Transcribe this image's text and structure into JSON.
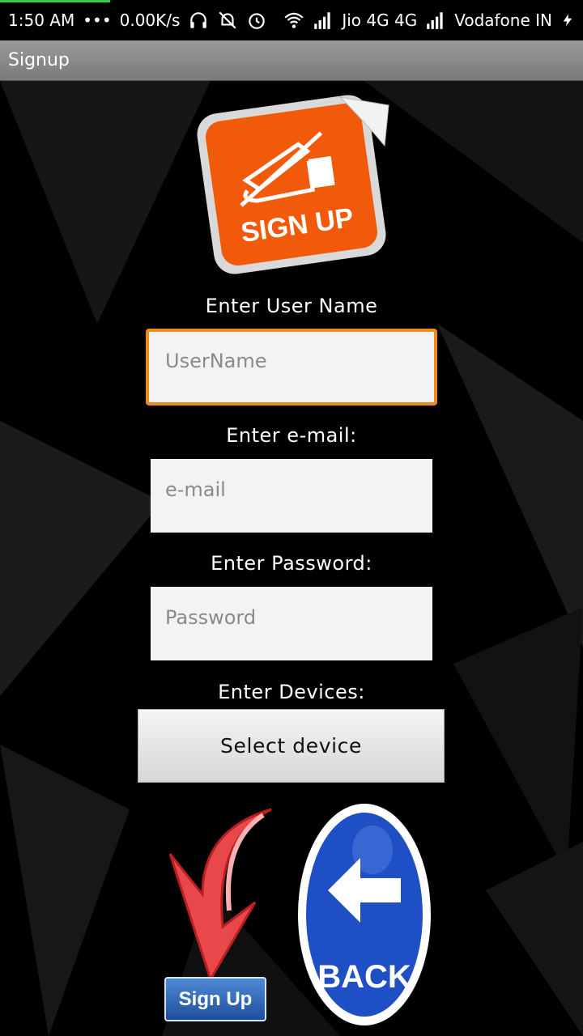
{
  "status_bar": {
    "time": "1:50 AM",
    "dots": "•••",
    "speed": "0.00K/s",
    "carrier1": "Jio 4G 4G",
    "carrier2": "Vodafone IN",
    "icons": [
      "headphones-icon",
      "bell-off-icon",
      "alarm-icon",
      "wifi-icon",
      "signal-icon",
      "signal-icon",
      "bolt-icon"
    ]
  },
  "action_bar": {
    "title": "Signup"
  },
  "logo": {
    "text": "SIGN UP"
  },
  "form": {
    "username_label": "Enter User Name",
    "username_placeholder": "UserName",
    "email_label": "Enter e-mail:",
    "email_placeholder": "e-mail",
    "password_label": "Enter Password:",
    "password_placeholder": "Password",
    "devices_label": "Enter Devices:",
    "select_device": "Select device"
  },
  "buttons": {
    "signup": "Sign Up",
    "back": "BACK"
  },
  "colors": {
    "accent_orange": "#f08a1c",
    "logo_orange": "#f05a0a",
    "back_blue": "#1f4fc4",
    "arrow_red": "#e8484a"
  }
}
